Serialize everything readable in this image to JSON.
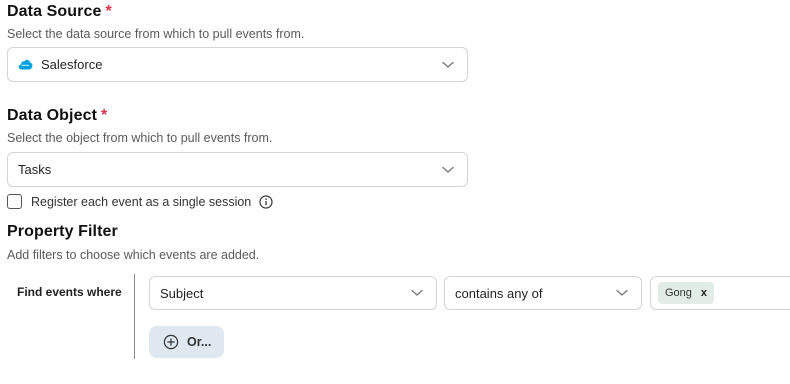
{
  "data_source": {
    "title": "Data Source",
    "required_mark": "*",
    "description": "Select the data source from which to pull events from.",
    "selected": "Salesforce",
    "icon": "salesforce-icon"
  },
  "data_object": {
    "title": "Data Object",
    "required_mark": "*",
    "description": "Select the object from which to pull events from.",
    "selected": "Tasks"
  },
  "single_session": {
    "label": "Register each event as a single session",
    "checked": false
  },
  "property_filter": {
    "title": "Property Filter",
    "description": "Add filters to choose which events are added.",
    "row_label": "Find events where",
    "property": "Subject",
    "operator": "contains any of",
    "values": [
      "Gong"
    ],
    "remove_symbol": "x",
    "or_button": "Or..."
  },
  "colors": {
    "required": "#e0324a",
    "salesforce": "#00a1e0",
    "chip_bg": "#e2ece7",
    "or_button_bg": "#dfe8f0"
  }
}
